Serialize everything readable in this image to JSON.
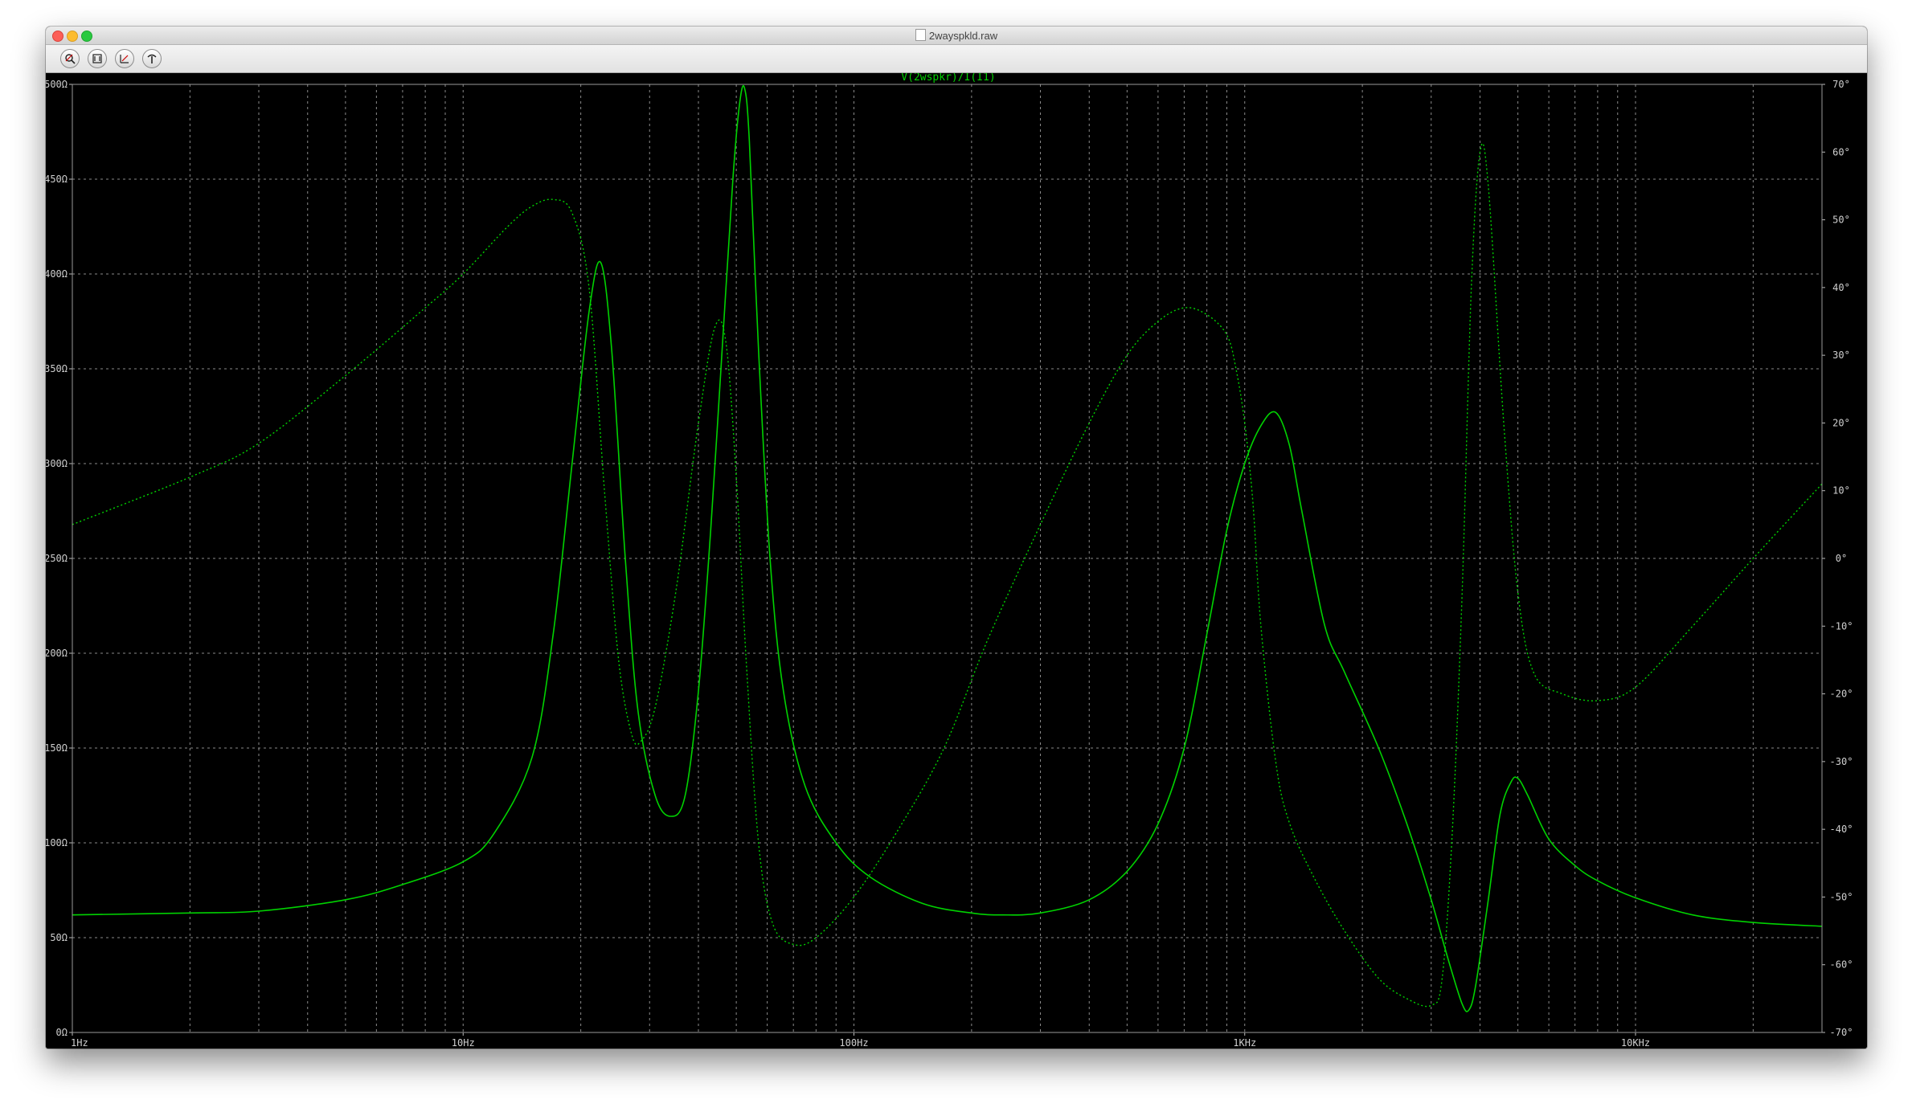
{
  "window": {
    "title": "2wayspkld.raw"
  },
  "toolbar": {
    "buttons": [
      {
        "icon": "zoom-icon"
      },
      {
        "icon": "autorange-icon"
      },
      {
        "icon": "zoom-extents-icon"
      },
      {
        "icon": "probe-icon"
      }
    ]
  },
  "colors": {
    "trace": "#00d200",
    "grid": "#8a8a8a",
    "background": "#000000",
    "tick_text": "#cfcfcf"
  },
  "chart_data": {
    "type": "line",
    "title": "V(2wspkr)/I(I1)",
    "x_scale": "log",
    "x_range_hz": [
      1,
      30000
    ],
    "x_ticks": [
      {
        "value": 1,
        "label": "1Hz"
      },
      {
        "value": 10,
        "label": "10Hz"
      },
      {
        "value": 100,
        "label": "100Hz"
      },
      {
        "value": 1000,
        "label": "1KHz"
      },
      {
        "value": 10000,
        "label": "10KHz"
      }
    ],
    "y_left_range": [
      0,
      500
    ],
    "y_left_ticks": [
      "0Ω",
      "50Ω",
      "100Ω",
      "150Ω",
      "200Ω",
      "250Ω",
      "300Ω",
      "350Ω",
      "400Ω",
      "450Ω",
      "500Ω"
    ],
    "y_right_range": [
      -70,
      70
    ],
    "y_right_ticks": [
      "-70°",
      "-60°",
      "-50°",
      "-40°",
      "-30°",
      "-20°",
      "-10°",
      "0°",
      "10°",
      "20°",
      "30°",
      "40°",
      "50°",
      "60°",
      "70°"
    ],
    "grid": true,
    "series": [
      {
        "style": "solid",
        "axis": "left",
        "points": [
          [
            1,
            62
          ],
          [
            2,
            63
          ],
          [
            3,
            64
          ],
          [
            5,
            70
          ],
          [
            7,
            78
          ],
          [
            10,
            90
          ],
          [
            12,
            105
          ],
          [
            15,
            145
          ],
          [
            17,
            210
          ],
          [
            19,
            300
          ],
          [
            21,
            380
          ],
          [
            22.5,
            406
          ],
          [
            24,
            360
          ],
          [
            26,
            250
          ],
          [
            28,
            170
          ],
          [
            31,
            125
          ],
          [
            34,
            114
          ],
          [
            37,
            125
          ],
          [
            40,
            180
          ],
          [
            43,
            265
          ],
          [
            46,
            360
          ],
          [
            49,
            450
          ],
          [
            51,
            490
          ],
          [
            52.5,
            498
          ],
          [
            54,
            470
          ],
          [
            57,
            360
          ],
          [
            61,
            250
          ],
          [
            66,
            180
          ],
          [
            75,
            130
          ],
          [
            90,
            100
          ],
          [
            110,
            82
          ],
          [
            150,
            68
          ],
          [
            200,
            63
          ],
          [
            240,
            62
          ],
          [
            300,
            63
          ],
          [
            400,
            70
          ],
          [
            500,
            85
          ],
          [
            600,
            110
          ],
          [
            700,
            150
          ],
          [
            800,
            210
          ],
          [
            900,
            265
          ],
          [
            1000,
            300
          ],
          [
            1100,
            320
          ],
          [
            1200,
            327
          ],
          [
            1300,
            310
          ],
          [
            1400,
            275
          ],
          [
            1600,
            215
          ],
          [
            1800,
            190
          ],
          [
            2200,
            150
          ],
          [
            2600,
            110
          ],
          [
            3000,
            70
          ],
          [
            3300,
            40
          ],
          [
            3600,
            15
          ],
          [
            3750,
            12
          ],
          [
            3900,
            25
          ],
          [
            4200,
            70
          ],
          [
            4500,
            115
          ],
          [
            4800,
            132
          ],
          [
            5000,
            134
          ],
          [
            5300,
            125
          ],
          [
            6000,
            102
          ],
          [
            7000,
            88
          ],
          [
            8000,
            80
          ],
          [
            10000,
            71
          ],
          [
            14000,
            62
          ],
          [
            20000,
            58
          ],
          [
            30000,
            56
          ]
        ]
      },
      {
        "style": "dotted",
        "axis": "right",
        "points": [
          [
            1,
            5
          ],
          [
            2,
            12
          ],
          [
            3,
            17
          ],
          [
            5,
            27
          ],
          [
            8,
            37
          ],
          [
            10,
            42
          ],
          [
            13,
            49
          ],
          [
            15,
            52
          ],
          [
            17,
            53
          ],
          [
            19,
            51
          ],
          [
            21,
            40
          ],
          [
            23,
            10
          ],
          [
            25,
            -15
          ],
          [
            27,
            -26
          ],
          [
            28.5,
            -27
          ],
          [
            31,
            -22
          ],
          [
            35,
            -5
          ],
          [
            40,
            20
          ],
          [
            44,
            34
          ],
          [
            47,
            32
          ],
          [
            50,
            12
          ],
          [
            53,
            -15
          ],
          [
            57,
            -42
          ],
          [
            62,
            -54
          ],
          [
            70,
            -57
          ],
          [
            80,
            -56
          ],
          [
            100,
            -50
          ],
          [
            130,
            -40
          ],
          [
            170,
            -28
          ],
          [
            220,
            -12
          ],
          [
            300,
            5
          ],
          [
            400,
            20
          ],
          [
            500,
            30
          ],
          [
            600,
            35
          ],
          [
            700,
            37
          ],
          [
            800,
            36
          ],
          [
            900,
            33
          ],
          [
            950,
            28
          ],
          [
            1000,
            20
          ],
          [
            1050,
            8
          ],
          [
            1100,
            -10
          ],
          [
            1200,
            -30
          ],
          [
            1300,
            -39
          ],
          [
            1500,
            -47
          ],
          [
            1800,
            -55
          ],
          [
            2200,
            -62
          ],
          [
            2600,
            -65
          ],
          [
            3000,
            -66
          ],
          [
            3200,
            -62
          ],
          [
            3400,
            -40
          ],
          [
            3600,
            -5
          ],
          [
            3800,
            40
          ],
          [
            4000,
            60
          ],
          [
            4200,
            55
          ],
          [
            4600,
            20
          ],
          [
            5000,
            -5
          ],
          [
            5500,
            -17
          ],
          [
            6500,
            -20
          ],
          [
            8000,
            -21
          ],
          [
            10000,
            -19
          ],
          [
            14000,
            -10
          ],
          [
            20000,
            0
          ],
          [
            30000,
            11
          ]
        ]
      }
    ]
  }
}
